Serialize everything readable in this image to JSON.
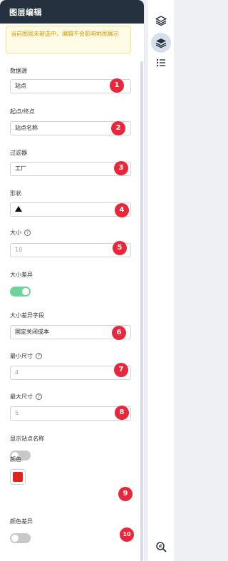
{
  "panel": {
    "title": "图层编辑",
    "notice": "当前图层未被选中，编辑不会影响地图展示"
  },
  "fields": {
    "data_source": {
      "label": "数据源",
      "value": "站点"
    },
    "start_end": {
      "label": "起点/终点",
      "value": "站点名称"
    },
    "filter": {
      "label": "过滤器",
      "value": "工厂"
    },
    "shape": {
      "label": "形状"
    },
    "size": {
      "label": "大小",
      "placeholder": "10"
    },
    "size_diff": {
      "label": "大小差异",
      "toggle_on": true
    },
    "size_diff_field": {
      "label": "大小差异字段",
      "value": "固定关闭成本"
    },
    "min_size": {
      "label": "最小尺寸",
      "placeholder": "4"
    },
    "max_size": {
      "label": "最大尺寸",
      "placeholder": "5"
    },
    "show_site_name": {
      "label": "显示站点名称",
      "toggle_on": false
    },
    "color": {
      "label": "颜色",
      "swatch": "#e0231d"
    },
    "color_diff": {
      "label": "颜色差异",
      "toggle_on": false
    }
  },
  "badges": [
    "1",
    "2",
    "3",
    "4",
    "5",
    "6",
    "7",
    "8",
    "9",
    "10"
  ],
  "colors": {
    "header_bg": "#25313f",
    "badge_red": "#e8283a",
    "toggle_on": "#6fd49a"
  },
  "rail_icons": [
    "layers-icon",
    "layers-active-icon",
    "list-icon",
    "zoom-to-layer-icon"
  ]
}
